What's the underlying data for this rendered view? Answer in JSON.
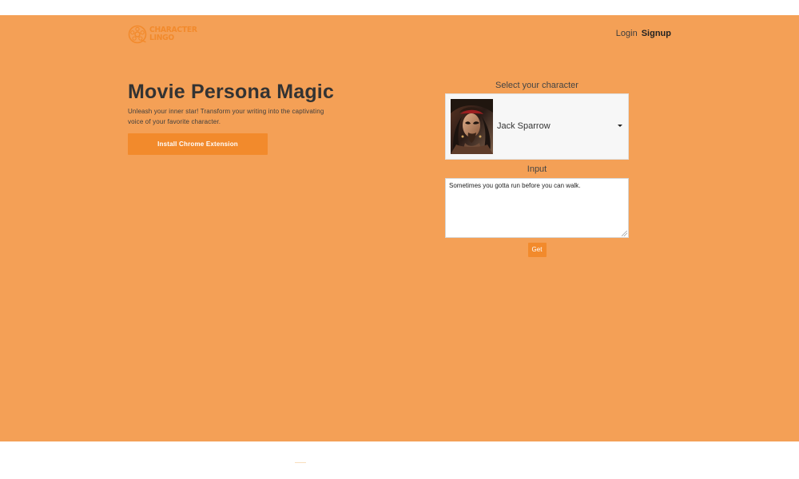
{
  "brand": {
    "line1": "CHARACTER",
    "line2": "LINGO",
    "logo_icon": "film-reel-logo-icon"
  },
  "nav": {
    "login": "Login",
    "signup": "Signup"
  },
  "hero": {
    "title": "Movie Persona Magic",
    "subtitle": "Unleash your inner star! Transform your writing into the captivating voice of your favorite character.",
    "install_button": "Install Chrome Extension"
  },
  "converter": {
    "select_label": "Select your character",
    "selected_character": "Jack Sparrow",
    "dropdown_icon": "caret-down-icon",
    "input_label": "Input",
    "input_value": "Sometimes you gotta run before you can walk.",
    "submit_button": "Get"
  },
  "colors": {
    "hero_background": "#f4a056",
    "accent": "#f28a2c",
    "text": "#333333"
  }
}
